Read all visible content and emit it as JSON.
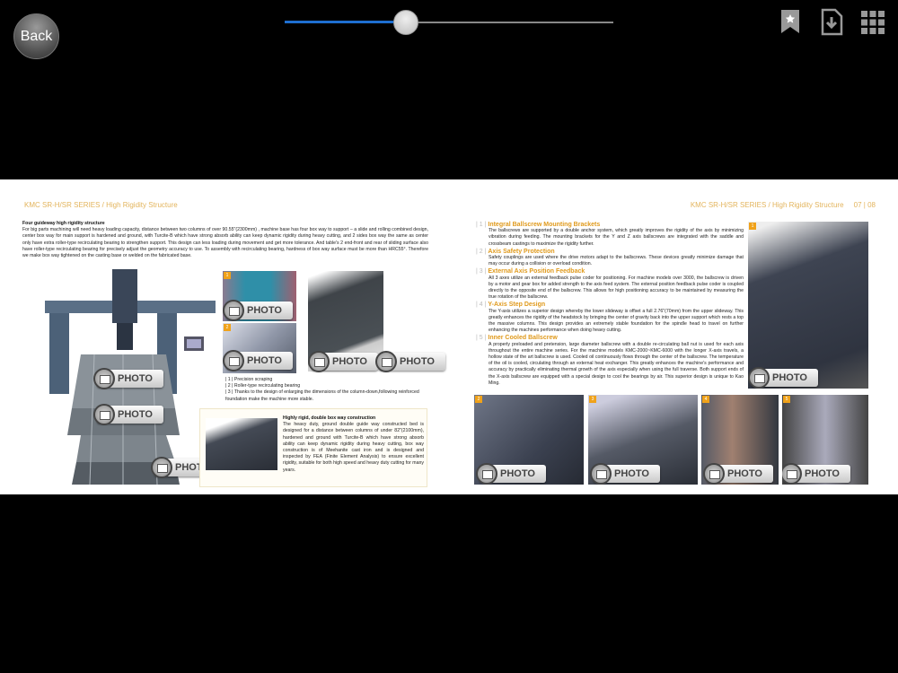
{
  "toolbar": {
    "back_label": "Back",
    "progress_percent": 37,
    "icons": [
      "bookmark-star-icon",
      "download-document-icon",
      "grid-view-icon"
    ],
    "accent": "#1e6fd0"
  },
  "left_page": {
    "header": "KMC SR-H/SR  SERIES  /  High Rigidity Structure",
    "heading": "Four guideway high rigidity structure",
    "body": "For big parts machining will need heavy loading capacity, distance between two columns of over 90.55\"(2300mm) , machine base has four box way to support – a slide and rolling combined design, center box way for main support is hardened and ground, with Turcite-B which have strong absorb ability can keep dynamic rigidity during heavy cutting, and 2 sides box way the same as center only have extra roller-type recirculating bearing to strengthen support. This design can less loading during movement and get more tolerance. And table's 2 end-front and rear of sliding surface also have roller-type recirculating bearing for precisely adjust the geometry accuracy to use. To assembly with recirculating bearing, hardness of box way surface must be more than HRC55°. Therefore we make box way tightened on the casting base or welded on the fabricated base.",
    "list": [
      {
        "n": "| 1 |",
        "t": "Precision scraping"
      },
      {
        "n": "| 2 |",
        "t": "Roller-type recirculating bearing"
      },
      {
        "n": "| 3 |",
        "t": "Thanks to the design of enlarging the dimensions of the column-down,following reinforced foundation make the machine more stable."
      }
    ],
    "box_title": "Highly rigid, double box way construction",
    "box_body": "The heavy duty, ground double guide way constructed bed is designed for a distance between columns of under 82\"(2100mm), hardened and ground with Turcite-B which have strong absorb ability can keep dynamic rigidity during heavy cutting, box way construction is of Meehanite cast iron and is designed and inspected by FEA (Finite Element Analysis) to ensure excellent rigidity, suitable for both high speed and heavy duty cutting for many years.",
    "photo_numbers": [
      "1",
      "2"
    ]
  },
  "right_page": {
    "header": "KMC SR-H/SR  SERIES  /  High Rigidity Structure",
    "page_numbers": "07 | 08",
    "sections": [
      {
        "n": "| 1 |",
        "title": "Integral Ballscrew Mounting Brackets",
        "body": "The ballscrews are supported by a double anchor system, which greatly improves the rigidity of the axis by minimizing vibration during feeding. The mounting brackets for the Y and Z axis ballscrews are integrated with the saddle and crossbeam castings to maximize the rigidity further."
      },
      {
        "n": "| 2 |",
        "title": "Axis Safety Protection",
        "body": "Safety couplings are used where the drive motors adapt to the ballscrews. These devices greatly minimize damage that may occur during a collision or overload condition."
      },
      {
        "n": "| 3 |",
        "title": "External Axis Position Feedback",
        "body": "All 3 axes utilize an external feedback pulse coder for positioning. For machine models over 3000, the ballscrew is driven by a motor and gear box for added strength to the axis feed system. The external position feedback pulse coder is coupled directly to the opposite end of the ballscrew. This allows for high positioning accuracy to be maintained by measuring the true rotation of the ballscrew."
      },
      {
        "n": "| 4 |",
        "title": "Y-Axis Step Design",
        "body": "The Y-axis utilizes a superior design whereby the lower slideway is offset a full 2.76\"(70mm) from the upper slideway. This greatly enhances the rigidity of the headstock by bringing the center of gravity back into the upper support which rests a top the massive columns. This design provides an extremely stable foundation for the spindle head to travel on further enhancing the machines performance when doing heavy cutting."
      },
      {
        "n": "| 5 |",
        "title": "Inner Cooled Ballscrew",
        "body": "A properly preloaded and pretension, large diameter ballscrew with a double re-circulating ball nut is used for each axis throughout the entire machine series. For the machine models KMC-2000~KMC-6000 with the longer X-axis travels, a hollow state of the art ballscrew is used. Cooled oil continuously flows through the center of the ballscrew. The temperature of the oil is cooled, circulating through an external heat exchanger. This greatly enhances the machine's performance and accuracy by practically eliminating thermal growth of the axis especially when using the full traverse. Both support ends of the X-axis ballscrew are equipped with a special design to cool the bearings by air. This superior design is unique to Kao Ming."
      }
    ],
    "photo_numbers": [
      "1",
      "2",
      "3",
      "4",
      "5"
    ]
  },
  "photo_badge": "PHOTO"
}
